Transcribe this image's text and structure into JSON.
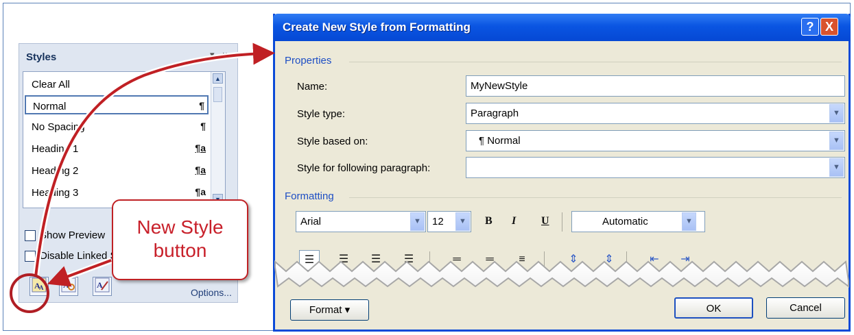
{
  "styles_pane": {
    "title": "Styles",
    "pin_icon": "▾",
    "close_icon": "×",
    "items": [
      {
        "label": "Clear All",
        "mark": ""
      },
      {
        "label": "Normal",
        "mark": "¶"
      },
      {
        "label": "No Spacing",
        "mark": "¶"
      },
      {
        "label": "Heading 1",
        "mark": "¶a"
      },
      {
        "label": "Heading 2",
        "mark": "¶a"
      },
      {
        "label": "Heading 3",
        "mark": "¶a"
      }
    ],
    "show_preview_label": "Show Preview",
    "disable_linked_label": "Disable Linked Styles",
    "options_label": "Options..."
  },
  "callout": {
    "text": "New Style\nbutton",
    "color": "#c8202a"
  },
  "dialog": {
    "title": "Create New Style from Formatting",
    "help_label": "?",
    "close_label": "X",
    "properties_label": "Properties",
    "name_label": "Name:",
    "name_value": "MyNewStyle",
    "style_type_label": "Style type:",
    "style_type_value": "Paragraph",
    "based_on_label": "Style based on:",
    "based_on_value": "¶ Normal",
    "following_label": "Style for following paragraph:",
    "following_value": "",
    "formatting_label": "Formatting",
    "font_value": "Arial",
    "size_value": "12",
    "bold_label": "B",
    "italic_label": "I",
    "underline_label": "U",
    "color_value": "Automatic",
    "format_button_label": "Format ▾",
    "ok_label": "OK",
    "cancel_label": "Cancel",
    "title_color": "#0a55e2"
  }
}
